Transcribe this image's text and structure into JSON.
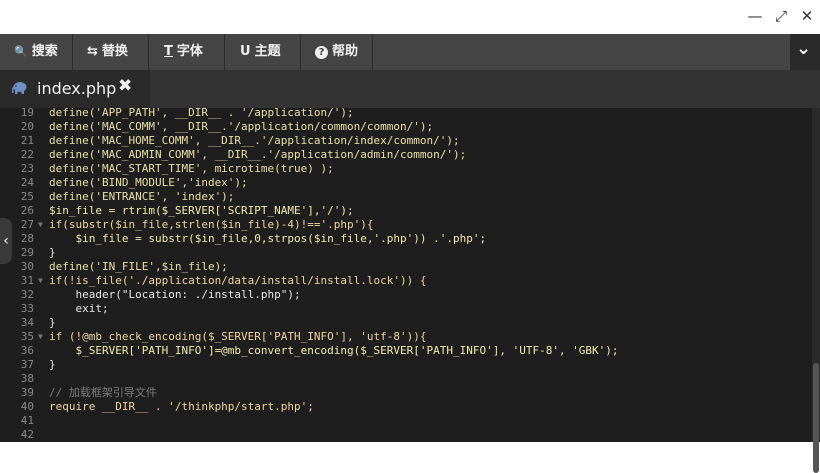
{
  "window": {
    "minimize_glyph": "—",
    "maximize_glyph": "⤢",
    "close_glyph": "✕"
  },
  "toolbar": {
    "items": [
      {
        "icon": "search-icon",
        "glyph": "🔍",
        "label": "搜索"
      },
      {
        "icon": "replace-icon",
        "glyph": "⇆",
        "label": "替换"
      },
      {
        "icon": "font-icon",
        "glyph": "T",
        "label": "字体"
      },
      {
        "icon": "theme-icon",
        "glyph": "U",
        "label": "主题"
      },
      {
        "icon": "help-icon",
        "glyph": "?",
        "label": "帮助"
      }
    ],
    "menu_glyph": "⌄"
  },
  "tab": {
    "label": "index.php",
    "close_glyph": "✖",
    "icon": "php-elephant-icon"
  },
  "editor": {
    "side_toggle_glyph": "‹",
    "colors": {
      "background": "#1e1e1e",
      "keyword": "#f08a5d",
      "function": "#e4e28a",
      "comment": "#7c7c7c"
    },
    "lines": [
      {
        "n": "19",
        "fold": "",
        "text": "define('APP_PATH', __DIR__ . '/application/');"
      },
      {
        "n": "20",
        "fold": "",
        "text": "define('MAC_COMM', __DIR__.'/application/common/common/');"
      },
      {
        "n": "21",
        "fold": "",
        "text": "define('MAC_HOME_COMM', __DIR__.'/application/index/common/');"
      },
      {
        "n": "22",
        "fold": "",
        "text": "define('MAC_ADMIN_COMM', __DIR__.'/application/admin/common/');"
      },
      {
        "n": "23",
        "fold": "",
        "text": "define('MAC_START_TIME', microtime(true) );"
      },
      {
        "n": "24",
        "fold": "",
        "text": "define('BIND_MODULE','index');"
      },
      {
        "n": "25",
        "fold": "",
        "text": "define('ENTRANCE', 'index');"
      },
      {
        "n": "26",
        "fold": "",
        "text": "$in_file = rtrim($_SERVER['SCRIPT_NAME'],'/');"
      },
      {
        "n": "27",
        "fold": "▼",
        "text": "if(substr($in_file,strlen($in_file)-4)!=='.php'){"
      },
      {
        "n": "28",
        "fold": "",
        "text": "    $in_file = substr($in_file,0,strpos($in_file,'.php')) .'.php';"
      },
      {
        "n": "29",
        "fold": "",
        "text": "}"
      },
      {
        "n": "30",
        "fold": "",
        "text": "define('IN_FILE',$in_file);"
      },
      {
        "n": "31",
        "fold": "▼",
        "text": "if(!is_file('./application/data/install/install.lock')) {"
      },
      {
        "n": "32",
        "fold": "",
        "text": "    header(\"Location: ./install.php\");"
      },
      {
        "n": "33",
        "fold": "",
        "text": "    exit;"
      },
      {
        "n": "34",
        "fold": "",
        "text": "}"
      },
      {
        "n": "35",
        "fold": "▼",
        "text": "if (!@mb_check_encoding($_SERVER['PATH_INFO'], 'utf-8')){"
      },
      {
        "n": "36",
        "fold": "",
        "text": "    $_SERVER['PATH_INFO']=@mb_convert_encoding($_SERVER['PATH_INFO'], 'UTF-8', 'GBK');"
      },
      {
        "n": "37",
        "fold": "",
        "text": "}"
      },
      {
        "n": "38",
        "fold": "",
        "text": ""
      },
      {
        "n": "39",
        "fold": "",
        "text": "// 加载框架引导文件"
      },
      {
        "n": "40",
        "fold": "",
        "text": "require __DIR__ . '/thinkphp/start.php';"
      },
      {
        "n": "41",
        "fold": "",
        "text": ""
      },
      {
        "n": "42",
        "fold": "",
        "text": ""
      }
    ]
  }
}
